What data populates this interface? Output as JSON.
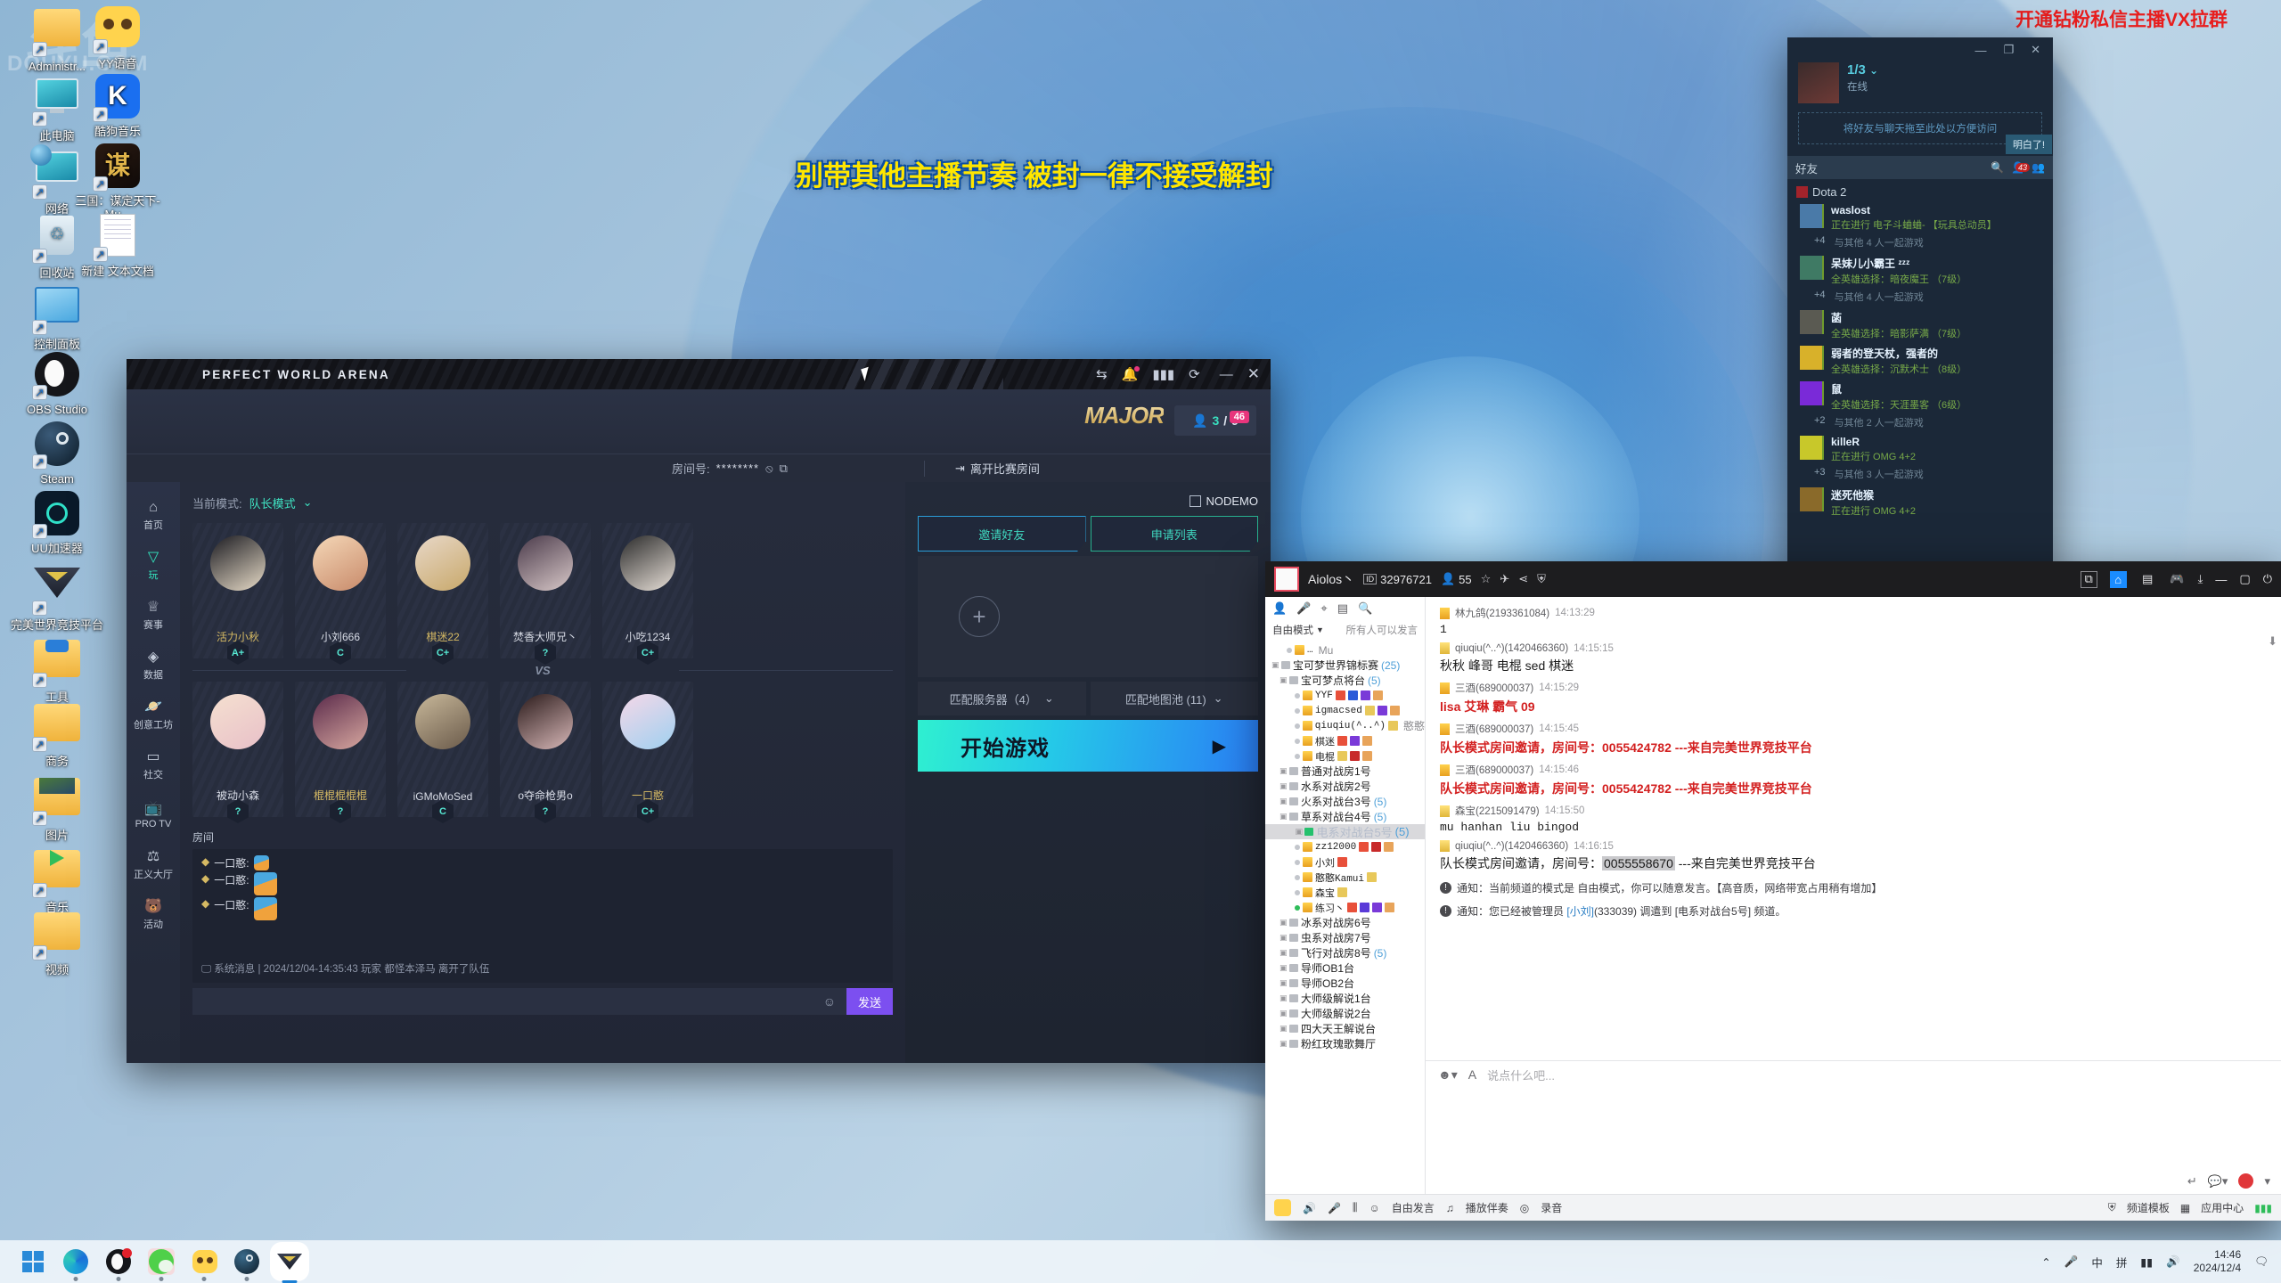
{
  "desktop": {
    "watermark": "斗鱼",
    "watermark_sub": "DOUYU.COM",
    "icons": [
      {
        "label": "Administr...",
        "kind": "folder"
      },
      {
        "label": "YY语音",
        "kind": "yy"
      },
      {
        "label": "此电脑",
        "kind": "pc"
      },
      {
        "label": "酷狗音乐",
        "kind": "kugou"
      },
      {
        "label": "网络",
        "kind": "net"
      },
      {
        "label": "三国：谋定天下-Mu...",
        "kind": "sanguo"
      },
      {
        "label": "回收站",
        "kind": "bin"
      },
      {
        "label": "新建 文本文档",
        "kind": "txt"
      },
      {
        "label": "控制面板",
        "kind": "cpl"
      },
      {
        "label": "OBS Studio",
        "kind": "obs"
      },
      {
        "label": "Steam",
        "kind": "steam"
      },
      {
        "label": "UU加速器",
        "kind": "uu"
      },
      {
        "label": "完美世界竞技平台",
        "kind": "pwa"
      },
      {
        "label": "工具",
        "kind": "folder2"
      },
      {
        "label": "商务",
        "kind": "folder3"
      },
      {
        "label": "图片",
        "kind": "folder4"
      },
      {
        "label": "音乐",
        "kind": "folder5"
      },
      {
        "label": "视频",
        "kind": "folder6"
      }
    ]
  },
  "banners": {
    "top_right": "开通钻粉私信主播VX拉群",
    "center": "别带其他主播节奏 被封一律不接受解封"
  },
  "game": {
    "title": "PERFECT WORLD ARENA",
    "titlebar_icons": [
      "swap-icon",
      "bell-icon",
      "signal-icon",
      "shield-refresh-icon",
      "minimize-icon",
      "close-icon"
    ],
    "major_logo": "MAJOR",
    "major_badge": {
      "current": "3",
      "total": "9",
      "separator": "/",
      "count_badge": "46"
    },
    "room_label": "房间号:",
    "room_value": "********",
    "leave_room": "离开比赛房间",
    "mode_label": "当前模式:",
    "mode_value": "队长模式",
    "sidebar": [
      {
        "label": "首页",
        "icon": "home-icon"
      },
      {
        "label": "玩",
        "icon": "play-icon"
      },
      {
        "label": "赛事",
        "icon": "trophy-icon"
      },
      {
        "label": "数据",
        "icon": "data-icon"
      },
      {
        "label": "创意工坊",
        "icon": "workshop-icon"
      },
      {
        "label": "社交",
        "icon": "social-icon"
      },
      {
        "label": "PRO TV",
        "icon": "tv-icon"
      },
      {
        "label": "正义大厅",
        "icon": "justice-icon"
      },
      {
        "label": "活动",
        "icon": "event-icon"
      }
    ],
    "team_a": [
      {
        "name": "活力小秋",
        "rank": "A+",
        "color": "#d5b963"
      },
      {
        "name": "小刘666",
        "rank": "C",
        "color": "#d8dce6"
      },
      {
        "name": "棋迷22",
        "rank": "C+",
        "color": "#d5b963"
      },
      {
        "name": "焚香大师兄丶",
        "rank": "?",
        "color": "#d8dce6"
      },
      {
        "name": "小吃1234",
        "rank": "C+",
        "color": "#d8dce6"
      }
    ],
    "vs": "VS",
    "team_b": [
      {
        "name": "被动小森",
        "rank": "?",
        "color": "#d8dce6"
      },
      {
        "name": "棍棍棍棍棍",
        "rank": "?",
        "color": "#d5b963"
      },
      {
        "name": "iGMoMoSed",
        "rank": "C",
        "color": "#d8dce6"
      },
      {
        "name": "o夺命枪男o",
        "rank": "?",
        "color": "#d8dce6"
      },
      {
        "name": "一口憨",
        "rank": "C+",
        "color": "#d5b963"
      }
    ],
    "room_section_label": "房间",
    "chat": [
      {
        "name": "一口憨:",
        "type": "sticker"
      },
      {
        "name": "一口憨:",
        "type": "sticker"
      },
      {
        "name": "一口憨:",
        "type": "sticker-small"
      }
    ],
    "system_msg": "系统消息 | 2024/12/04-14:35:43 玩家 都怪本泽马 离开了队伍",
    "send_label": "发送",
    "nodemo": "NODEMO",
    "invite_friend": "邀请好友",
    "apply_list": "申请列表",
    "match_server": "匹配服务器（4）",
    "match_map": "匹配地图池 (11)",
    "start_game": "开始游戏"
  },
  "steam": {
    "status_count": "1/3",
    "status": "在线",
    "drag_hint": "将好友与聊天拖至此处以方便访问",
    "got_it": "明白了!",
    "friends_label": "好友",
    "pending_count": "43",
    "category": "Dota 2",
    "friends": [
      {
        "name": "waslost",
        "status": "正在进行 电子斗蛐蛐- 【玩具总动员】",
        "group": "+4",
        "group_text": "与其他 4 人一起游戏",
        "av": "#4a7aa8"
      },
      {
        "name": "呆妹儿小霸王 ᶻᶻᶻ",
        "status": "全英雄选择：暗夜魔王 （7级）",
        "group": "+4",
        "group_text": "与其他 4 人一起游戏",
        "av": "#3f7a64"
      },
      {
        "name": "菡",
        "status": "全英雄选择：暗影萨满 （7级）",
        "group": "",
        "group_text": "",
        "av": "#5a5a52"
      },
      {
        "name": "弱者的登天杖，强者的",
        "status": "全英雄选择：沉默术士 （8级）",
        "group": "",
        "group_text": "",
        "av": "#d8b12a"
      },
      {
        "name": "鼠",
        "status": "全英雄选择：天涯墨客 （6级）",
        "group": "+2",
        "group_text": "与其他 2 人一起游戏",
        "av": "#7a2ad8"
      },
      {
        "name": "killeR",
        "status": "正在进行 OMG 4+2",
        "group": "+3",
        "group_text": "与其他 3 人一起游戏",
        "av": "#c8c82a"
      },
      {
        "name": "迷死他猴",
        "status": "正在进行 OMG 4+2",
        "group": "",
        "group_text": "",
        "av": "#8a6a2a"
      }
    ]
  },
  "yy": {
    "nickname": "Aiolos丶",
    "id_chip": "ID",
    "channel_id": "32976721",
    "member_count": "55",
    "header_icons": [
      "star-icon",
      "plane-icon",
      "share-icon",
      "shield-icon"
    ],
    "window_icons": [
      "screen-icon",
      "home-icon",
      "list-icon",
      "game-icon",
      "download-icon",
      "minimize-icon",
      "maximize-icon",
      "power-icon"
    ],
    "left_tools": [
      "person-icon",
      "mic-icon",
      "location-icon",
      "board-icon",
      "search-icon"
    ],
    "mode": "自由模式",
    "mode_right": "所有人可以发言",
    "tree": [
      {
        "depth": 1,
        "label": "…",
        "type": "user",
        "extra": "Mu",
        "lock": true
      },
      {
        "depth": 0,
        "label": "宝可梦世界锦标赛",
        "count": "(25)",
        "type": "channel",
        "lock": true
      },
      {
        "depth": 1,
        "label": "宝可梦点将台",
        "count": "(5)",
        "type": "channel",
        "lock": true
      },
      {
        "depth": 2,
        "label": "YYF",
        "type": "user",
        "medals": [
          "#e8503a",
          "#2a5ad8",
          "#7a3ad8",
          "#e8a45a"
        ]
      },
      {
        "depth": 2,
        "label": "igmacsed",
        "type": "user",
        "medals": [
          "#e8c85a",
          "#7a3ad8",
          "#e8a45a"
        ]
      },
      {
        "depth": 2,
        "label": "qiuqiu(^..^)",
        "type": "user",
        "extra": "憨憨",
        "medals": [
          "#e8c85a"
        ]
      },
      {
        "depth": 2,
        "label": "棋迷",
        "type": "user",
        "medals": [
          "#e8503a",
          "#7a3ad8",
          "#e8a45a"
        ]
      },
      {
        "depth": 2,
        "label": "电棍",
        "type": "user",
        "medals": [
          "#e8c85a",
          "#c82a2a",
          "#e8a45a"
        ]
      },
      {
        "depth": 1,
        "label": "普通对战房1号",
        "type": "channel",
        "lock": true
      },
      {
        "depth": 1,
        "label": "水系对战房2号",
        "type": "channel",
        "lock": true
      },
      {
        "depth": 1,
        "label": "火系对战台3号",
        "count": "(5)",
        "type": "channel",
        "lock": true
      },
      {
        "depth": 1,
        "label": "草系对战台4号",
        "count": "(5)",
        "type": "channel",
        "lock": true
      },
      {
        "depth": 1,
        "label": "电系对战台5号",
        "count": "(5)",
        "type": "channel",
        "lock": "open",
        "selected": true
      },
      {
        "depth": 2,
        "label": "zz12000",
        "type": "user",
        "medals": [
          "#e8503a",
          "#c82a2a",
          "#e8a45a"
        ]
      },
      {
        "depth": 2,
        "label": "小刘",
        "type": "user",
        "medals": [
          "#e8503a"
        ]
      },
      {
        "depth": 2,
        "label": "憨憨Kamui",
        "type": "user",
        "medals": [
          "#e8c85a"
        ]
      },
      {
        "depth": 2,
        "label": "森宝",
        "type": "user",
        "medals": [
          "#e8c85a"
        ]
      },
      {
        "depth": 2,
        "label": "练习丶",
        "type": "user",
        "online": true,
        "medals": [
          "#e8503a",
          "#5a3ad8",
          "#7a3ad8",
          "#e8a45a"
        ]
      },
      {
        "depth": 1,
        "label": "冰系对战房6号",
        "type": "channel",
        "lock": true
      },
      {
        "depth": 1,
        "label": "虫系对战房7号",
        "type": "channel",
        "lock": true
      },
      {
        "depth": 1,
        "label": "飞行对战房8号",
        "count": "(5)",
        "type": "channel",
        "lock": true
      },
      {
        "depth": 1,
        "label": "导师OB1台",
        "type": "channel",
        "lock": true
      },
      {
        "depth": 1,
        "label": "导师OB2台",
        "type": "channel",
        "lock": true
      },
      {
        "depth": 1,
        "label": "大师级解说1台",
        "type": "channel",
        "lock": true
      },
      {
        "depth": 1,
        "label": "大师级解说2台",
        "type": "channel",
        "lock": true
      },
      {
        "depth": 1,
        "label": "四大天王解说台",
        "type": "channel",
        "lock": true
      },
      {
        "depth": 1,
        "label": "粉红玫瑰歌舞厅",
        "type": "channel",
        "lock": true
      }
    ],
    "messages": [
      {
        "sender": "林九鸽(2193361084)",
        "time": "14:13:29",
        "body": "1",
        "style": "mono",
        "badge": "gift"
      },
      {
        "sender": "qiuqiu(^..^)(1420466360)",
        "time": "14:15:15",
        "body": "秋秋 峰哥 电棍 sed 棋迷",
        "style": "normal",
        "badge": "crown"
      },
      {
        "sender": "三酒(689000037)",
        "time": "14:15:29",
        "body": "lisa 艾琳 霸气 09",
        "style": "red",
        "badge": "gift"
      },
      {
        "sender": "三酒(689000037)",
        "time": "14:15:45",
        "body": "队长模式房间邀请，房间号：0055424782 ---来自完美世界竞技平台",
        "style": "red",
        "badge": "gift"
      },
      {
        "sender": "三酒(689000037)",
        "time": "14:15:46",
        "body": "队长模式房间邀请，房间号：0055424782 ---来自完美世界竞技平台",
        "style": "red",
        "badge": "gift"
      },
      {
        "sender": "森宝(2215091479)",
        "time": "14:15:50",
        "body": "mu hanhan liu bingod",
        "style": "mono",
        "badge": "crown"
      },
      {
        "sender": "qiuqiu(^..^)(1420466360)",
        "time": "14:16:15",
        "body": "队长模式房间邀请，房间号：",
        "body_hl": "0055558670",
        "body_after": " ---来自完美世界竞技平台",
        "style": "normal",
        "badge": "crown"
      }
    ],
    "notices": [
      {
        "text": "通知：当前频道的模式是 自由模式，你可以随意发言。【高音质，网络带宽占用稍有增加】"
      },
      {
        "prefix": "通知：您已经被管理员 ",
        "link": "[小刘]",
        "mid": "(333039) 调遣到 [电系对战台5号] 频道。"
      }
    ],
    "compose_placeholder": "说点什么吧...",
    "bottom_bar": {
      "speak": "自由发言",
      "music": "播放伴奏",
      "record": "录音",
      "template": "频道模板",
      "appcenter": "应用中心"
    }
  },
  "taskbar": {
    "apps": [
      "start-icon",
      "edge-icon",
      "obs-icon",
      "wechat-icon",
      "yy-icon",
      "steam-icon",
      "pwa-icon"
    ],
    "tray": [
      "chevron-up-icon",
      "mic-icon",
      "ime-cn",
      "ime-pinyin",
      "wifi-icon",
      "volume-icon"
    ],
    "ime_cn": "中",
    "ime_mode": "拼",
    "time": "14:46",
    "date": "2024/12/4"
  }
}
